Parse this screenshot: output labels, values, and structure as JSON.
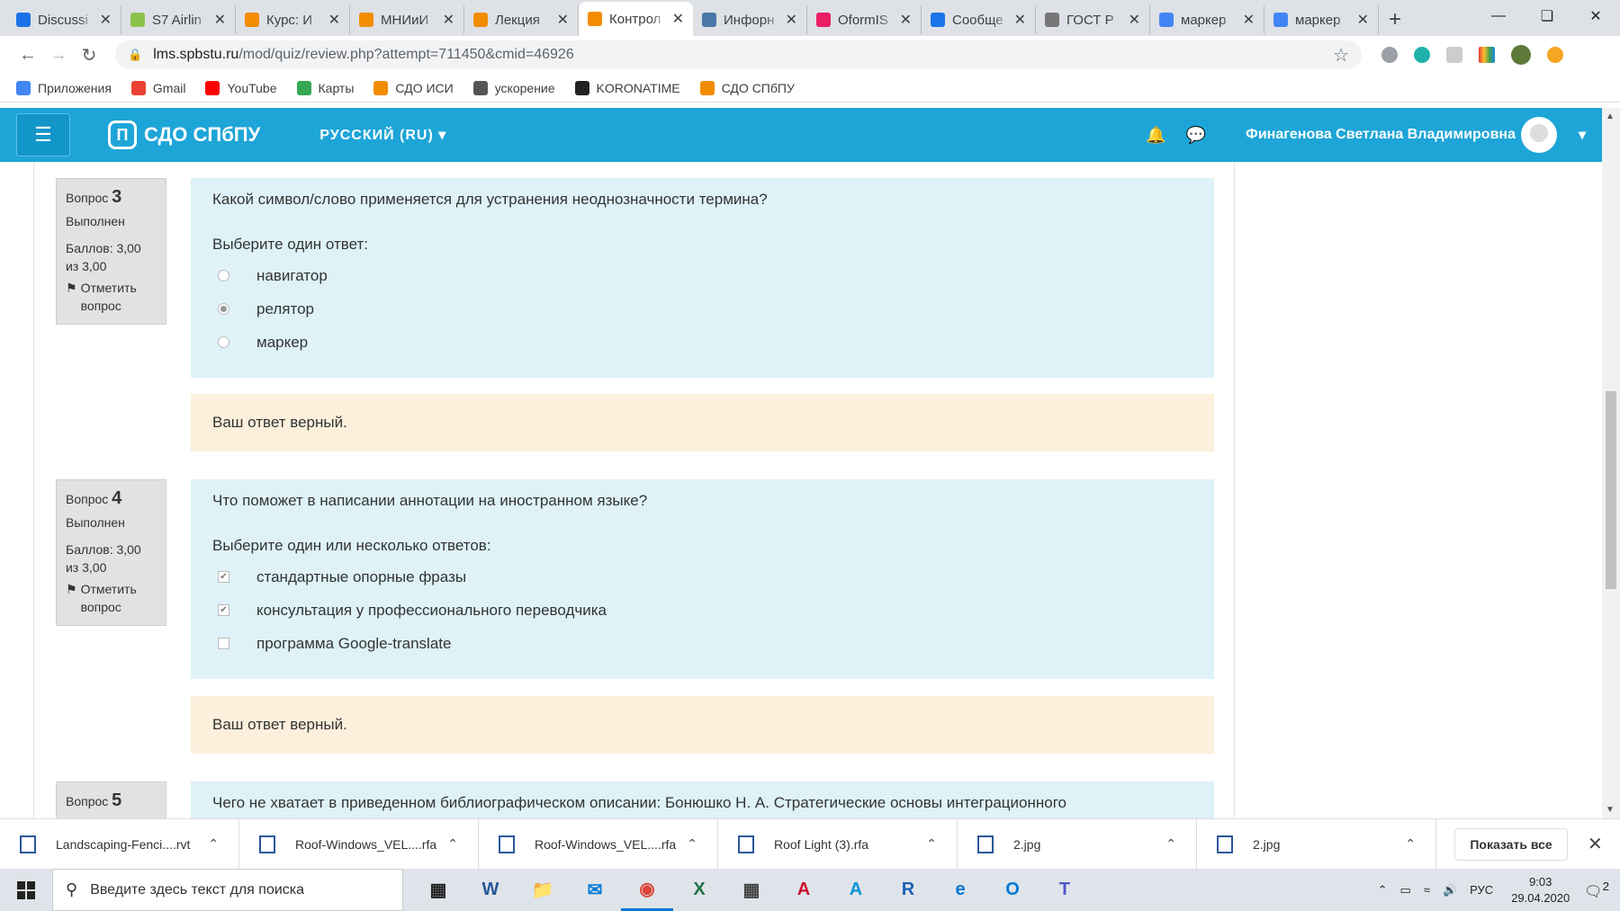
{
  "browser": {
    "tabs": [
      {
        "title": "Discussi",
        "color": "#1a73e8"
      },
      {
        "title": "S7 Airlin",
        "color": "#8bc34a"
      },
      {
        "title": "Курс: И",
        "color": "#f28c00"
      },
      {
        "title": "МНИиИ",
        "color": "#f28c00"
      },
      {
        "title": "Лекция",
        "color": "#f28c00"
      },
      {
        "title": "Контрол",
        "color": "#f28c00"
      },
      {
        "title": "Инфорн",
        "color": "#4a76a8"
      },
      {
        "title": "OformIS",
        "color": "#e91e63"
      },
      {
        "title": "Сообще",
        "color": "#1a73e8"
      },
      {
        "title": "ГОСТ Р",
        "color": "#777777"
      },
      {
        "title": "маркер",
        "color": "#4285f4"
      },
      {
        "title": "маркер",
        "color": "#4285f4"
      }
    ],
    "active_tab": 5,
    "new_tab_symbol": "+",
    "close_symbol": "✕",
    "url_host": "lms.spbstu.ru",
    "url_path": "/mod/quiz/review.php?attempt=711450&cmid=46926",
    "bookmarks": [
      {
        "label": "Приложения",
        "icon": "apps-icon"
      },
      {
        "label": "Gmail",
        "icon": "gmail-icon"
      },
      {
        "label": "YouTube",
        "icon": "youtube-icon"
      },
      {
        "label": "Карты",
        "icon": "maps-icon"
      },
      {
        "label": "СДО ИСИ",
        "icon": "moodle-icon"
      },
      {
        "label": "ускорение",
        "icon": "globe-icon"
      },
      {
        "label": "KORONATIME",
        "icon": "gear-icon"
      },
      {
        "label": "СДО СПбПУ",
        "icon": "moodle-icon"
      }
    ]
  },
  "moodle": {
    "brand": "СДО СПбПУ",
    "language": "РУССКИЙ (RU)",
    "user_name": "Финагенова Светлана Владимировна"
  },
  "questions": [
    {
      "label": "Вопрос",
      "number": "3",
      "status": "Выполнен",
      "score": "Баллов: 3,00 из 3,00",
      "flag_label": "Отметить вопрос",
      "text": "Какой символ/слово применяется для устранения неоднозначности термина?",
      "prompt": "Выберите один ответ:",
      "type": "radio",
      "options": [
        {
          "label": "навигатор",
          "selected": false
        },
        {
          "label": "релятор",
          "selected": true
        },
        {
          "label": "маркер",
          "selected": false
        }
      ],
      "feedback": "Ваш ответ верный."
    },
    {
      "label": "Вопрос",
      "number": "4",
      "status": "Выполнен",
      "score": "Баллов: 3,00 из 3,00",
      "flag_label": "Отметить вопрос",
      "text": "Что поможет в написании аннотации на иностранном языке?",
      "prompt": "Выберите один или несколько ответов:",
      "type": "check",
      "options": [
        {
          "label": "стандартные опорные фразы",
          "selected": true
        },
        {
          "label": "консультация у профессионального переводчика",
          "selected": true
        },
        {
          "label": "программа Google-translate",
          "selected": false
        }
      ],
      "feedback": "Ваш ответ верный."
    },
    {
      "label": "Вопрос",
      "number": "5",
      "text": "Чего не хватает в приведенном библиографическом описании: Бонюшко Н. А. Стратегические основы интеграционного"
    }
  ],
  "downloads": {
    "items": [
      "Landscaping-Fenci....rvt",
      "Roof-Windows_VEL....rfa",
      "Roof-Windows_VEL....rfa",
      "Roof Light (3).rfa",
      "2.jpg",
      "2.jpg"
    ],
    "show_all": "Показать все"
  },
  "taskbar": {
    "search_placeholder": "Введите здесь текст для поиска",
    "language": "РУС",
    "time": "9:03",
    "date": "29.04.2020",
    "notification_count": "2"
  }
}
